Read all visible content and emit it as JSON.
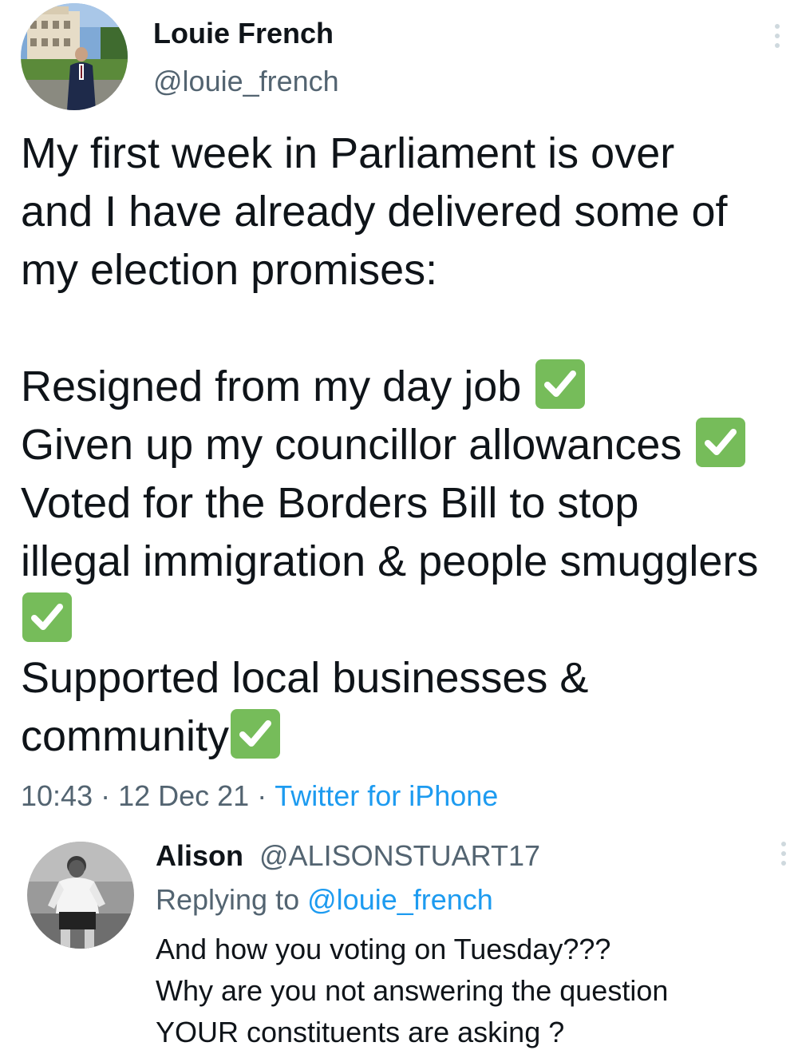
{
  "tweet": {
    "author_name": "Louie French",
    "author_handle": "@louie_french",
    "lines": [
      "My first week in Parliament is over",
      "and I have already delivered some of",
      "my election promises:",
      "Resigned from my day job",
      "Given up my councillor allowances",
      "Voted for the Borders Bill to stop",
      "illegal immigration & people smugglers",
      "Supported local businesses &",
      "community"
    ],
    "time": "10:43",
    "date": "12 Dec 21",
    "separator": "·",
    "source": "Twitter for iPhone"
  },
  "reply": {
    "author_name": "Alison",
    "author_handle": "@ALISONSTUART17",
    "replying_prefix": "Replying to",
    "replying_handle": "@louie_french",
    "lines": [
      "And how you voting on Tuesday???",
      "Why are you not answering the question",
      "YOUR constituents are asking ?"
    ]
  },
  "icons": {
    "check": "white-heavy-check-mark-icon",
    "more": "more-vertical-icon"
  },
  "colors": {
    "text": "#0f1419",
    "secondary": "#536471",
    "link": "#1d9bf0",
    "check_bg": "#76bc5a"
  }
}
